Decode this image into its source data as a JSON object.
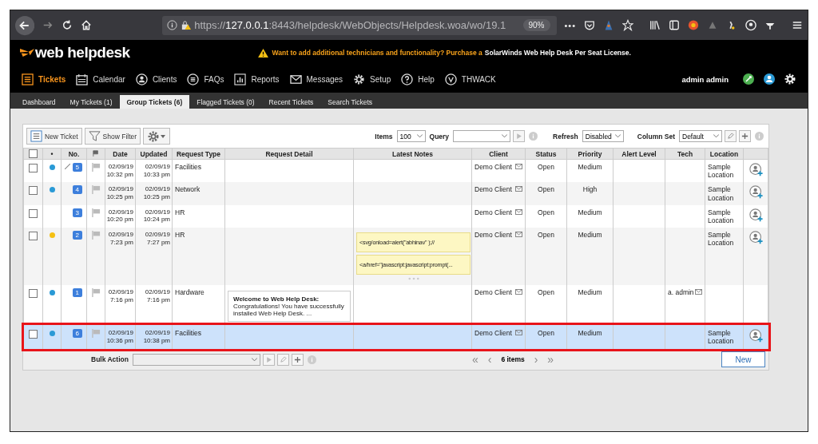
{
  "browser": {
    "url_scheme": "https://",
    "url_host": "127.0.0.1",
    "url_path": ":8443/helpdesk/WebObjects/Helpdesk.woa/wo/19.1",
    "zoom": "90%",
    "more": "•••"
  },
  "app": {
    "logo": "web helpdesk",
    "notice": "Want to add additional technicians and functionality? Purchase a",
    "notice_link": "SolarWinds Web Help Desk Per Seat License.",
    "user": "admin admin"
  },
  "nav": [
    {
      "label": "Tickets",
      "selected": true
    },
    {
      "label": "Calendar",
      "selected": false
    },
    {
      "label": "Clients",
      "selected": false
    },
    {
      "label": "FAQs",
      "selected": false
    },
    {
      "label": "Reports",
      "selected": false
    },
    {
      "label": "Messages",
      "selected": false
    },
    {
      "label": "Setup",
      "selected": false
    },
    {
      "label": "Help",
      "selected": false
    },
    {
      "label": "THWACK",
      "selected": false
    }
  ],
  "subtabs": [
    {
      "label": "Dashboard",
      "selected": false
    },
    {
      "label": "My Tickets (1)",
      "selected": false
    },
    {
      "label": "Group Tickets (6)",
      "selected": true
    },
    {
      "label": "Flagged Tickets (0)",
      "selected": false
    },
    {
      "label": "Recent Tickets",
      "selected": false
    },
    {
      "label": "Search Tickets",
      "selected": false
    }
  ],
  "toolbar": {
    "new_ticket": "New Ticket",
    "show_filter": "Show Filter",
    "items_label": "Items",
    "items_value": "100",
    "query_label": "Query",
    "refresh_label": "Refresh",
    "refresh_value": "Disabled",
    "column_set_label": "Column Set",
    "column_set_value": "Default"
  },
  "select_all_checked": false,
  "columns": [
    "•",
    "No.",
    "Date",
    "Updated",
    "Request Type",
    "Request Detail",
    "Latest Notes",
    "Client",
    "Status",
    "Priority",
    "Alert Level",
    "Tech",
    "Location"
  ],
  "rows": [
    {
      "selected": false,
      "highlighted": false,
      "color": "#2a9ad6",
      "edit_icon": true,
      "number": "5",
      "date": "02/09/19",
      "date_time": "10:32 pm",
      "updated": "02/09/19",
      "updated_time": "10:33 pm",
      "type": "Facilities",
      "notes": [],
      "client": "Demo Client",
      "status": "Open",
      "priority": "Medium",
      "location": "Sample Location",
      "assign_icon": true
    },
    {
      "selected": false,
      "highlighted": false,
      "color": "#2a9ad6",
      "edit_icon": false,
      "number": "4",
      "date": "02/09/19",
      "date_time": "10:25 pm",
      "updated": "02/09/19",
      "updated_time": "10:25 pm",
      "type": "Network",
      "notes": [],
      "client": "Demo Client",
      "status": "Open",
      "priority": "High",
      "location": "Sample Location",
      "assign_icon": true
    },
    {
      "selected": false,
      "highlighted": false,
      "edit_icon": false,
      "number": "3",
      "date": "02/09/19",
      "date_time": "10:20 pm",
      "updated": "02/09/19",
      "updated_time": "10:24 pm",
      "type": "HR",
      "notes": [],
      "client": "Demo Client",
      "status": "Open",
      "priority": "Medium",
      "location": "Sample Location",
      "assign_icon": true
    },
    {
      "selected": false,
      "highlighted": false,
      "color": "#f5c013",
      "edit_icon": false,
      "number": "2",
      "date": "02/09/19",
      "date_time": "7:23 pm",
      "updated": "02/09/19",
      "updated_time": "7:27 pm",
      "type": "HR",
      "notes": [
        "<svg/onload=alert(\"abhinav\" );//",
        "<a/href=\"javascript:javascript:prompt(..."
      ],
      "notes_more": true,
      "client": "Demo Client",
      "status": "Open",
      "priority": "Medium",
      "location": "Sample Location",
      "assign_icon": true
    },
    {
      "selected": false,
      "highlighted": false,
      "color": "#2a9ad6",
      "edit_icon": false,
      "number": "1",
      "date": "02/09/19",
      "date_time": "7:16 pm",
      "updated": "02/09/19",
      "updated_time": "7:16 pm",
      "type": "Hardware",
      "detail_title": "Welcome to Web Help Desk:",
      "detail_body": "Congratulations! You have successfully installed Web Help Desk. ...",
      "notes": [],
      "client": "Demo Client",
      "status": "Open",
      "priority": "Medium",
      "tech": "a. admin",
      "assign_icon": false
    },
    {
      "selected": true,
      "highlighted": true,
      "color": "#2a9ad6",
      "edit_icon": false,
      "number": "6",
      "date": "02/09/19",
      "date_time": "10:36 pm",
      "updated": "02/09/19",
      "updated_time": "10:38 pm",
      "type": "Facilities",
      "notes": [],
      "client": "Demo Client",
      "status": "Open",
      "priority": "Medium",
      "location": "Sample Location",
      "assign_icon": true
    }
  ],
  "footer": {
    "bulk_label": "Bulk Action",
    "first": "«",
    "prev": "‹",
    "count": "6 items",
    "next": "›",
    "last": "»",
    "new_button": "New"
  }
}
